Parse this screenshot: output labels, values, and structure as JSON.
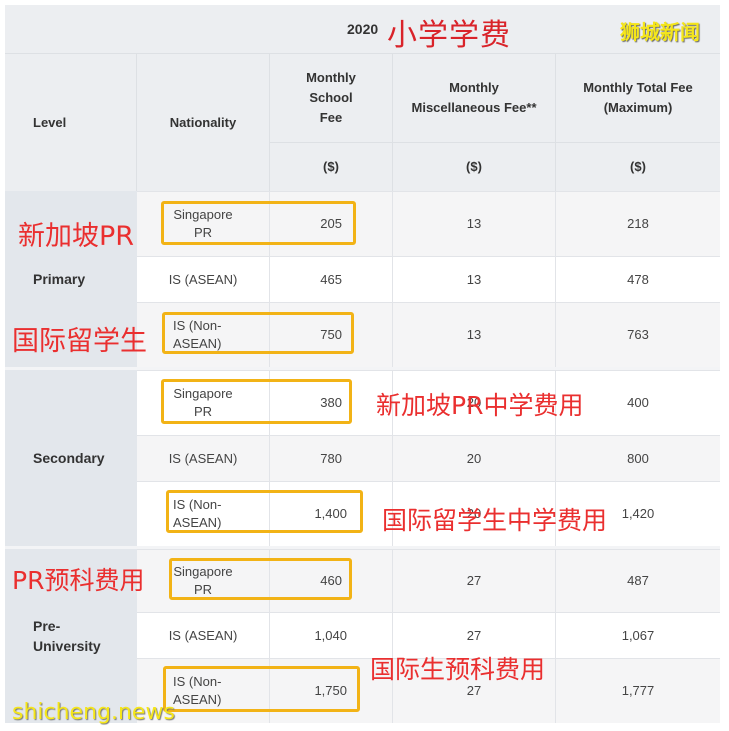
{
  "title": {
    "year": "2020",
    "cn_title": "小学学费",
    "brand": "狮城新闻"
  },
  "headers": {
    "level": "Level",
    "nationality": "Nationality",
    "school_fee": "Monthly School Fee",
    "misc_fee": "Monthly Miscellaneous Fee**",
    "total_fee": "Monthly Total Fee (Maximum)",
    "unit": "($)"
  },
  "levels": [
    {
      "name": "Primary",
      "rows": [
        {
          "nationality": "Singapore PR",
          "school_fee": "205",
          "misc_fee": "13",
          "total_fee": "218"
        },
        {
          "nationality": "IS (ASEAN)",
          "school_fee": "465",
          "misc_fee": "13",
          "total_fee": "478"
        },
        {
          "nationality": "IS (Non-ASEAN)",
          "school_fee": "750",
          "misc_fee": "13",
          "total_fee": "763"
        }
      ]
    },
    {
      "name": "Secondary",
      "rows": [
        {
          "nationality": "Singapore PR",
          "school_fee": "380",
          "misc_fee": "20",
          "total_fee": "400"
        },
        {
          "nationality": "IS (ASEAN)",
          "school_fee": "780",
          "misc_fee": "20",
          "total_fee": "800"
        },
        {
          "nationality": "IS (Non-ASEAN)",
          "school_fee": "1,400",
          "misc_fee": "20",
          "total_fee": "1,420"
        }
      ]
    },
    {
      "name": "Pre-University",
      "rows": [
        {
          "nationality": "Singapore PR",
          "school_fee": "460",
          "misc_fee": "27",
          "total_fee": "487"
        },
        {
          "nationality": "IS (ASEAN)",
          "school_fee": "1,040",
          "misc_fee": "27",
          "total_fee": "1,067"
        },
        {
          "nationality": "IS (Non-ASEAN)",
          "school_fee": "1,750",
          "misc_fee": "27",
          "total_fee": "1,777"
        }
      ]
    }
  ],
  "annotations": {
    "primary_pr": "新加坡PR",
    "primary_intl": "国际留学生",
    "secondary_pr": "新加坡PR中学费用",
    "secondary_intl": "国际留学生中学费用",
    "preu_pr": "PR预科费用",
    "preu_intl": "国际生预科费用"
  },
  "watermark": "shicheng.news",
  "colors": {
    "annotation_red": "#ea2f2f",
    "highlight_box": "#f2b316",
    "brand_yellow": "#f5e61a",
    "title_red": "#d9232a"
  }
}
